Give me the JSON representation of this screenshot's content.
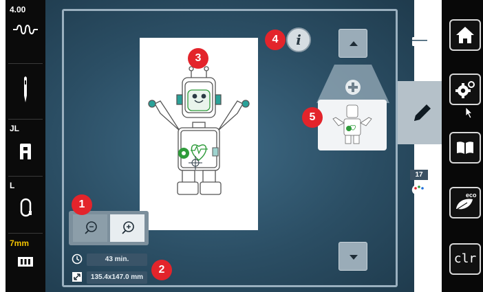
{
  "left_bar": {
    "stitch_length_value": "4.00",
    "presser_foot_label": "JL",
    "hoop_label": "L",
    "needle_size": "7mm"
  },
  "main": {
    "info_label": "i",
    "badges": [
      "1",
      "2",
      "3",
      "4",
      "5"
    ],
    "zoom_out_icon": "zoom-out-icon",
    "zoom_in_icon": "zoom-in-icon",
    "stitch_time": "43 min.",
    "design_size": "135.4x147.0 mm"
  },
  "right_panel": {
    "color_count": "17"
  },
  "right_bar": {
    "clr_label": "clr",
    "eco_label": "eco"
  },
  "colors": {
    "badge_red": "#e3242b",
    "stitch_green": "#2e9b3a",
    "active_tab": "#b5c1c9"
  }
}
